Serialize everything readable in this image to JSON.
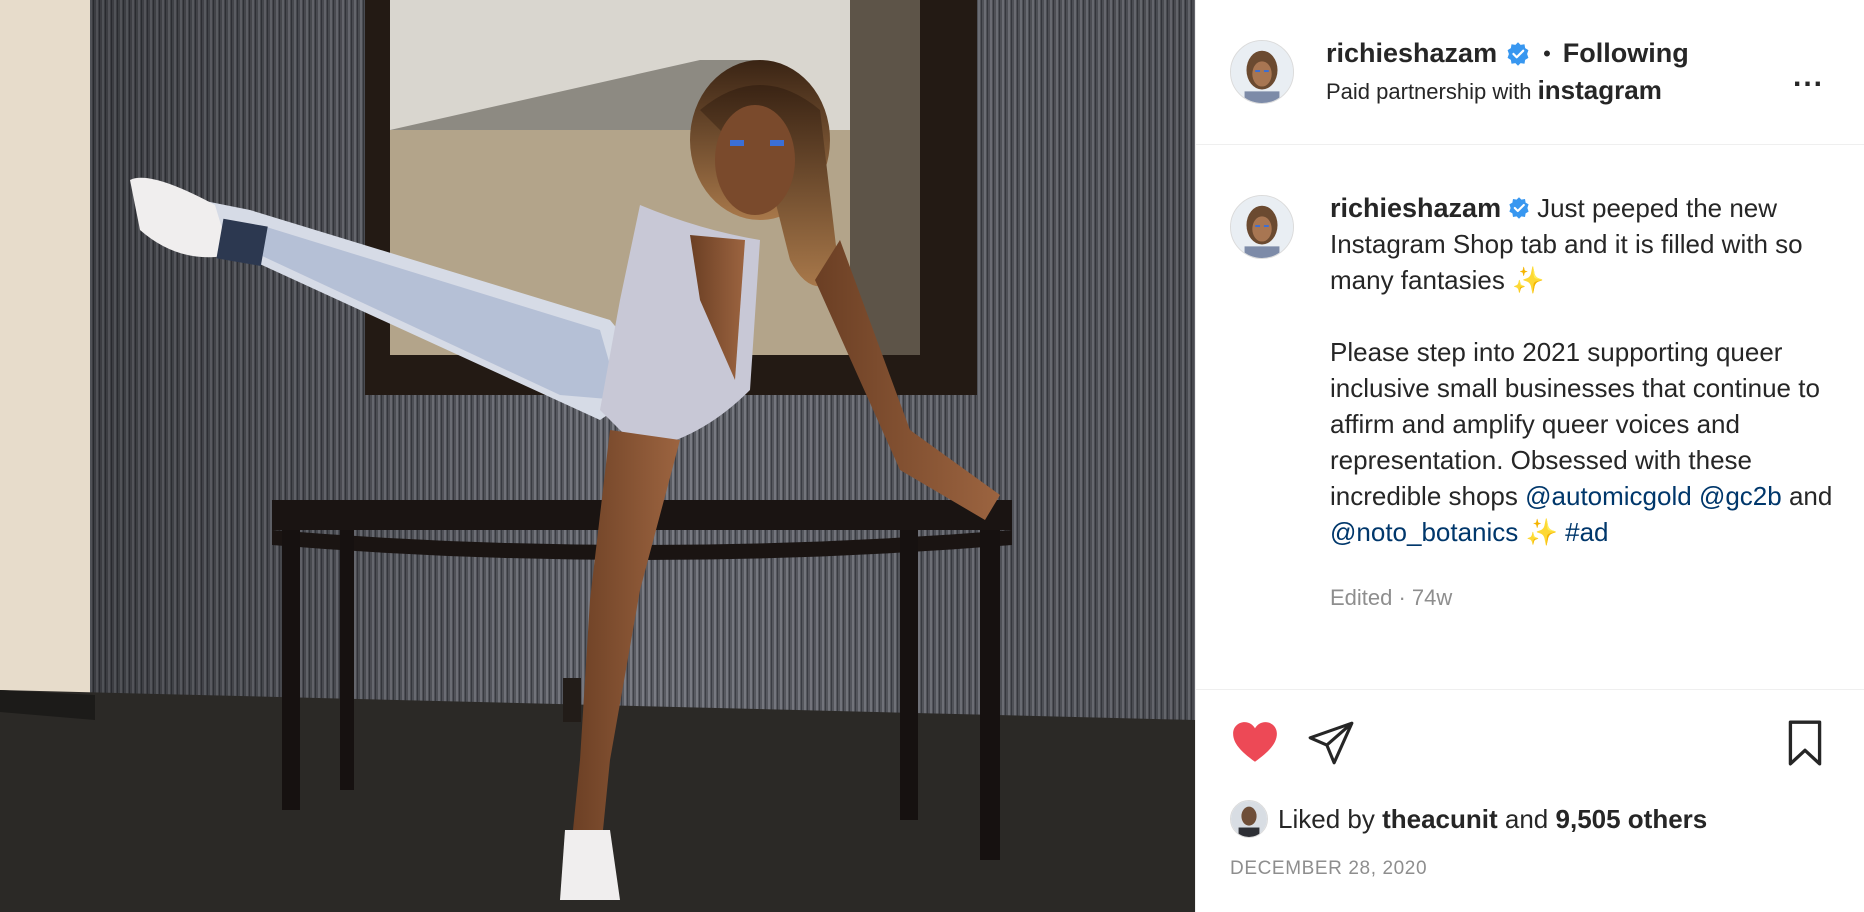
{
  "post": {
    "photo_alt": "",
    "header": {
      "username": "richieshazam",
      "separator": "•",
      "follow_status": "Following",
      "partnership_prefix": "Paid partnership with",
      "partner": "instagram",
      "more_label": "..."
    },
    "caption": {
      "username": "richieshazam",
      "line1": "Just peeped the new Instagram Shop tab and it is filled with so many fantasies ✨",
      "para2": "Please step into 2021 supporting queer inclusive small businesses that continue to affirm and amplify queer voices and representation. Obsessed with these incredible shops",
      "mention1": "@automicgold",
      "mention2": "@gc2b",
      "and_text": "and",
      "mention3": "@noto_botanics",
      "sparkle": "✨",
      "hashtag": "#ad",
      "edited": "Edited · 74w"
    },
    "actions": {
      "like_icon": "heart-filled-icon",
      "share_icon": "paper-plane-icon",
      "save_icon": "bookmark-icon"
    },
    "likes": {
      "prefix": "Liked by",
      "liker": "theacunit",
      "and_text": "and",
      "others": "9,505 others"
    },
    "date": "DECEMBER 28, 2020"
  },
  "colors": {
    "link": "#00376b",
    "verified": "#3897f0",
    "like": "#ed4956",
    "muted": "#8e8e8e"
  }
}
